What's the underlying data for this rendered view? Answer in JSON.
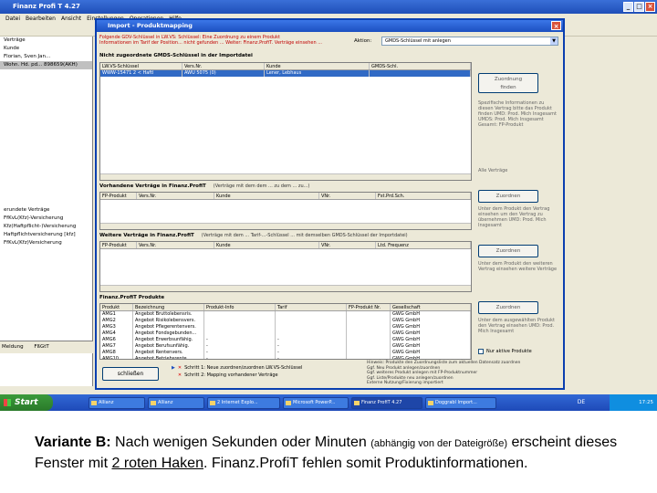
{
  "window": {
    "title": "Finanz Profi T 4.27"
  },
  "menu": [
    "Datei",
    "Bearbeiten",
    "Ansicht",
    "Einstellungen",
    "Operationen",
    "Hilfe"
  ],
  "left_tree": {
    "top": [
      "Verträge",
      "Kunde",
      "Florian, Sven Jan...",
      "Wohn. Hd. pd... 898659(AKH)"
    ],
    "section_title": "erundete Verträge",
    "lower": [
      "FfKvL(Kfz)-Versicherung",
      "Kfz(Haftpflicht-)Versicherung",
      "Haftpflichtversicherung [kfz]",
      "FfKvL(Kfz)Versicherung"
    ],
    "bottom_label": "Meldung",
    "bottom_tab": "FßGtT"
  },
  "dialog": {
    "title": "Import - Produktmapping",
    "info_lines": [
      "Folgende GDV-Schlüssel in LW.VS: Schlüssel: Eine Zuordnung zu einem Produkt",
      "Informationen im Tarif der Position... nicht gefunden ... Weiter: Finanz.ProfiT. Verträge einsehen ..."
    ],
    "aktion_label": "Aktion:",
    "aktion_value": "GMDS-Schlüssel mit anlegen",
    "section1": {
      "label": "Nicht zugeordnete GMDS-Schlüssel in der Importdatei",
      "columns": [
        "LW.VS-Schlüssel",
        "Vers.Nr.",
        "Kunde",
        "GMDS-Schl."
      ],
      "rows": [
        [
          "WWW-15471 2 < Haftl",
          "AWU 5075 (0)",
          "Lener, Lebhaus",
          ""
        ]
      ]
    },
    "section2": {
      "label": "Vorhandene Verträge in Finanz.ProfiT",
      "note": "(Verträge mit dem dem ... zu dem ... zu...)",
      "columns": [
        "FP-Produkt",
        "Vers.Nr.",
        "Kunde",
        "VNr.",
        "Fst.Prd.Sch."
      ],
      "rows": []
    },
    "section3": {
      "label": "Weitere Verträge in Finanz.ProfiT",
      "note": "(Verträge mit dem ... Tarif-...-Schlüssel ... mit demselben GMDS-Schlüssel der Importdatei)",
      "columns": [
        "FP-Produkt",
        "Vers.Nr.",
        "Kunde",
        "VNr.",
        "Ltd. Frequenz"
      ],
      "rows": []
    },
    "section4": {
      "label": "Finanz.ProfiT Produkte",
      "columns": [
        "Produkt",
        "Bezeichnung",
        "Produkt-Info",
        "Tarif",
        "FP-Produkt Nr.",
        "Gesellschaft"
      ],
      "rows": [
        [
          "AMG1",
          "Angebot Bruttolebensris.",
          "",
          "",
          "",
          "GWG GmbH"
        ],
        [
          "AMG2",
          "Angebot Risikolebensvers.",
          "",
          "",
          "",
          "GWG GmbH"
        ],
        [
          "AMG3",
          "Angebot Pflegerentenvers.",
          "",
          "",
          "",
          "GWG GmbH"
        ],
        [
          "AMG4",
          "Angebot Fondsgebunden...",
          "",
          "",
          "",
          "GWG GmbH"
        ],
        [
          "AMG6",
          "Angebot Erwerbsunfähig.",
          "-",
          "-",
          "",
          "GWG GmbH"
        ],
        [
          "AMG7",
          "Angebot Berufsunfähig.",
          "-",
          "-",
          "",
          "GWG GmbH"
        ],
        [
          "AMG8",
          "Angebot Rentenvers.",
          "-",
          "-",
          "",
          "GWG GmbH"
        ],
        [
          "AMG10",
          "Angebot Betriebsrente",
          "-",
          "-",
          "",
          "GWG GmbH"
        ],
        [
          "AMG11",
          "Angebot Grundfähigk.",
          "-",
          "-",
          "",
          "GWG GmbH"
        ],
        [
          "AMG12",
          "Angebot Kapitalvers.",
          "",
          "",
          "",
          "GWG GmbH"
        ]
      ]
    },
    "buttons": {
      "zuordnung": "Zuordnung\nfinden",
      "zuordnen": "Zuordnen",
      "zuordnen2": "Zuordnen",
      "zuordnen3": "Zuordnen",
      "schliessen": "schließen"
    },
    "side_texts": {
      "t1": "Spezifische Informationen zu diesen Vertrag bitte das Produkt finden UMD: Prod. Mich Insgesamt UMDS: Prod. Mich Insgesamt Gesamt: FP-Produkt",
      "t2": "Alle Verträge",
      "t3": "Unter dem Produkt den Vertrag einsehen um den Vertrag zu übernehmen UMD: Prod. Mich Insgesamt",
      "t4": "Unter dem Produkt den weiteren Vertrag einsehen weitere Verträge",
      "t5": "Unter dem ausgewählten Produkt den Vertrag einsehen UMD: Prod. Mich Insgesamt"
    },
    "checkbox_label": "Nur aktive Produkte",
    "steps": [
      "Schritt 1: Neue zuordnen/zuordnen LW.VS-Schlüssel",
      "Schritt 2: Mapping vorhandener Verträge"
    ],
    "legend": [
      "Hinweis: Produkte den Zuordnungsliste zum aktuellen Datensatz zuordnen",
      "Ggf. Neu Produkt anlegen/zuordnen",
      "Ggf. weiteres Produkt anlegen mit FP-Produktnummer",
      "Ggf. Liste/Produkte neu anlegen/zuordnen",
      "Externe Nutzung/Fixierung importiert"
    ]
  },
  "taskbar": {
    "start": "Start",
    "tasks": [
      "Allianz",
      "Allianz",
      "2 Internet Explo...",
      "Microsoft PowerP...",
      "Finanz ProfiT 4.27",
      "Doggrabl Import..."
    ],
    "lang": "DE",
    "clock": "17:25"
  },
  "caption": {
    "lead": "Variante B:",
    "part1": " Nach wenigen Sekunden oder Minuten ",
    "small": "(abhängig von der Dateigröße)",
    "part2": " erscheint dieses Fenster mit ",
    "emph": "2 roten Haken",
    "part3": ". Finanz.ProfiT fehlen somit Produktinformationen."
  }
}
